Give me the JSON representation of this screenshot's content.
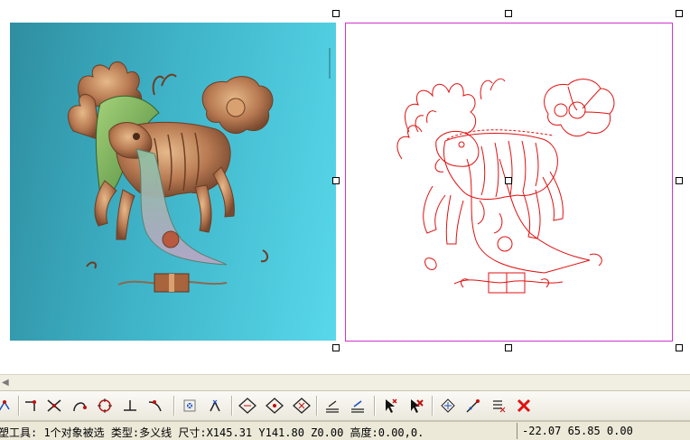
{
  "status_bar": {
    "message": "塑工具: 1个对象被选 类型:多义线 尺寸:X145.31 Y141.80 Z0.00 高度:0.00,0.",
    "coords": "-22.07 65.85 0.00"
  },
  "toolbar": {
    "buttons": [
      {
        "icon": "curve-node-icon"
      },
      {
        "icon": "corner-icon"
      },
      {
        "icon": "intersect-icon"
      },
      {
        "icon": "arc-icon"
      },
      {
        "icon": "circle-snap-icon"
      },
      {
        "icon": "perpendicular-icon"
      },
      {
        "icon": "tangent-icon"
      },
      {
        "icon": "center-point-icon"
      },
      {
        "icon": "point-snap-icon"
      },
      {
        "icon": "diamond-icon"
      },
      {
        "icon": "diamond-node-icon"
      },
      {
        "icon": "diamond-cross-icon"
      },
      {
        "icon": "align-layer-icon"
      },
      {
        "icon": "align-layer-blue-icon"
      },
      {
        "icon": "select-arrow-icon"
      },
      {
        "icon": "deselect-arrow-icon"
      },
      {
        "icon": "transform-icon"
      },
      {
        "icon": "edit-node-icon"
      },
      {
        "icon": "list-edit-icon"
      },
      {
        "icon": "delete-icon"
      }
    ]
  },
  "colors": {
    "selection_border": "#d232d2",
    "vector_stroke": "#e01010",
    "delete": "#e01010"
  }
}
